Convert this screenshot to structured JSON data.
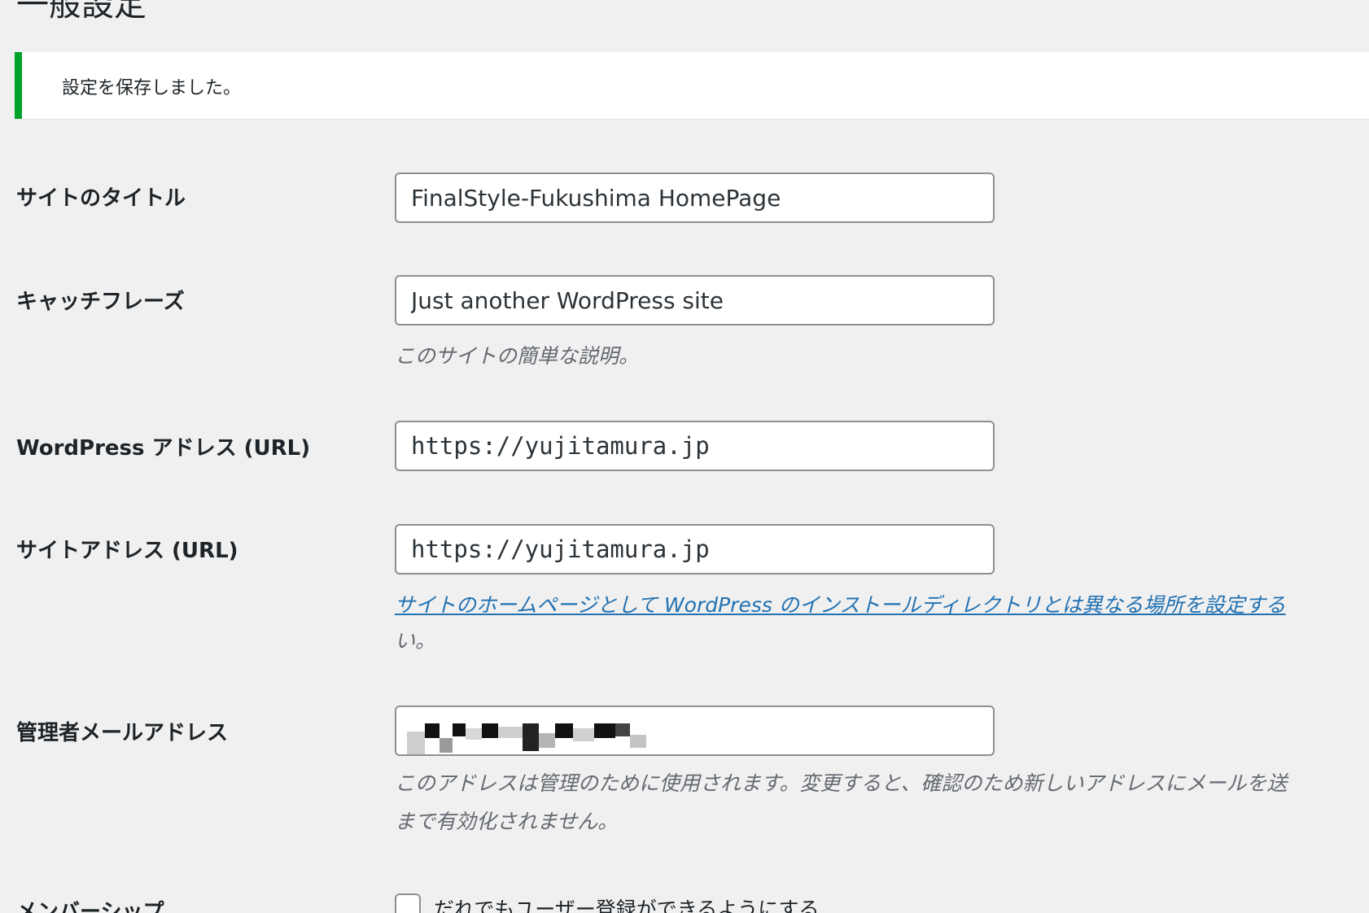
{
  "page_title": "一般設定",
  "notice": {
    "text": "設定を保存しました。",
    "accent_color": "#00a32a"
  },
  "fields": {
    "site_title": {
      "label": "サイトのタイトル",
      "value": "FinalStyle-Fukushima HomePage"
    },
    "tagline": {
      "label": "キャッチフレーズ",
      "value": "Just another WordPress site",
      "description": "このサイトの簡単な説明。"
    },
    "wp_address": {
      "label": "WordPress アドレス (URL)",
      "value": "https://yujitamura.jp"
    },
    "site_address": {
      "label": "サイトアドレス (URL)",
      "value": "https://yujitamura.jp",
      "description_link": "サイトのホームページとして WordPress のインストールディレクトリとは異なる場所を設定する",
      "description_tail": "い。"
    },
    "admin_email": {
      "label": "管理者メールアドレス",
      "value": "",
      "description_line1": "このアドレスは管理のために使用されます。変更すると、確認のため新しいアドレスにメールを送",
      "description_line2": "まで有効化されません。"
    },
    "membership": {
      "label": "メンバーシップ",
      "checkbox_label": "だれでもユーザー登録ができるようにする",
      "checked": false
    }
  },
  "colors": {
    "background": "#f0f0f1",
    "link": "#2271b1",
    "description": "#646970",
    "input_border": "#8c8f94"
  }
}
